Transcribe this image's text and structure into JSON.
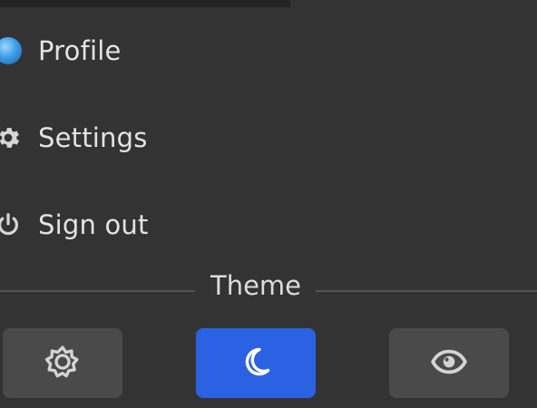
{
  "menu": {
    "items": [
      {
        "label": "Profile",
        "icon": "avatar"
      },
      {
        "label": "Settings",
        "icon": "gear-icon"
      },
      {
        "label": "Sign out",
        "icon": "power-icon"
      }
    ]
  },
  "theme": {
    "section_label": "Theme",
    "options": [
      {
        "icon": "sun-icon",
        "active": false
      },
      {
        "icon": "moon-icon",
        "active": true
      },
      {
        "icon": "eye-icon",
        "active": false
      }
    ],
    "active_color": "#2b62e3",
    "inactive_color": "#4a4a4a"
  },
  "colors": {
    "background": "#333333",
    "text": "#e3e3e3"
  }
}
